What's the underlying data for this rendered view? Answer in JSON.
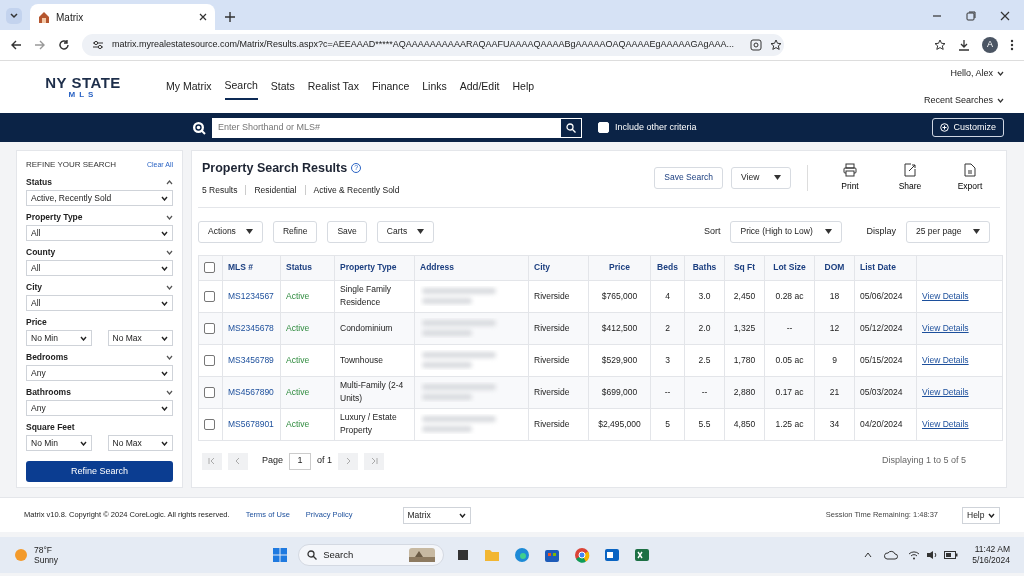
{
  "browser": {
    "tab_title": "Matrix",
    "url": "matrix.myrealestatesource.com/Matrix/Results.aspx?c=AEEAAAD*****AQAAAAAAAAAARAQAAFUAAAAQAAAABgAAAAAOAQAAAAEgAAAAAGAgAAA...",
    "profile": "A"
  },
  "site": {
    "logo_top": "NY STATE",
    "logo_bottom": "MLS",
    "nav": [
      {
        "label": "My Matrix",
        "selected": false
      },
      {
        "label": "Search",
        "selected": true
      },
      {
        "label": "Stats",
        "selected": false
      },
      {
        "label": "Realist Tax",
        "selected": false
      },
      {
        "label": "Finance",
        "selected": false
      },
      {
        "label": "Links",
        "selected": false
      },
      {
        "label": "Add/Edit",
        "selected": false
      },
      {
        "label": "Help",
        "selected": false
      }
    ],
    "greeting": "Hello, Alex",
    "recent": "Recent Searches"
  },
  "searchbar": {
    "placeholder": "Enter Shorthand or MLS#",
    "include_label": "Include other criteria",
    "include_checked": false,
    "customize": "Customize"
  },
  "refine": {
    "title": "REFINE YOUR SEARCH",
    "clear": "Clear All",
    "filters": [
      {
        "label": "Status",
        "expanded": true,
        "values": [
          "Active, Recently Sold"
        ]
      },
      {
        "label": "Property Type",
        "expanded": false,
        "values": [
          "All"
        ]
      },
      {
        "label": "County",
        "expanded": false,
        "values": [
          "All"
        ]
      },
      {
        "label": "City",
        "expanded": false,
        "values": [
          "All"
        ]
      },
      {
        "label": "Price",
        "values": [
          "No Min",
          "No Max"
        ]
      },
      {
        "label": "Bedrooms",
        "expanded": false,
        "values": [
          "Any"
        ]
      },
      {
        "label": "Bathrooms",
        "expanded": false,
        "values": [
          "Any"
        ]
      },
      {
        "label": "Square Feet",
        "values": [
          "No Min",
          "No Max"
        ]
      }
    ],
    "button": "Refine Search"
  },
  "results": {
    "title": "Property Search Results",
    "help": "?",
    "summary": [
      "5 Results",
      "Residential",
      "Active & Recently Sold"
    ],
    "save_search": "Save Search",
    "view": "View",
    "tools": [
      {
        "label": "Print",
        "kind": "print"
      },
      {
        "label": "Share",
        "kind": "share"
      },
      {
        "label": "Export",
        "kind": "export"
      }
    ],
    "actions": [
      {
        "label": "Actions",
        "kind": "dropdown"
      },
      {
        "label": "Refine",
        "kind": "plain"
      },
      {
        "label": "Save",
        "kind": "plain"
      },
      {
        "label": "Carts",
        "kind": "dropdown"
      }
    ],
    "sort_label": "Sort",
    "sort_value": "Price (High to Low)",
    "display_label": "Display",
    "display_value": "25 per page",
    "select_all": false,
    "columns": [
      "MLS #",
      "Status",
      "Property Type",
      "Address",
      "City",
      "Price",
      "Beds",
      "Baths",
      "Sq Ft",
      "Lot Size",
      "DOM",
      "List Date"
    ],
    "rows": [
      {
        "selected": false,
        "mls": "MS1234567",
        "status": "Active",
        "type": "Single Family Residence",
        "city": "Riverside",
        "price": "$765,000",
        "beds": "4",
        "baths": "3.0",
        "sqft": "2,450",
        "lot": "0.28 ac",
        "dom": "18",
        "date": "05/06/2024",
        "link": "View Details"
      },
      {
        "selected": false,
        "mls": "MS2345678",
        "status": "Active",
        "type": "Condominium",
        "city": "Riverside",
        "price": "$412,500",
        "beds": "2",
        "baths": "2.0",
        "sqft": "1,325",
        "lot": "--",
        "dom": "12",
        "date": "05/12/2024",
        "link": "View Details"
      },
      {
        "selected": false,
        "mls": "MS3456789",
        "status": "Active",
        "type": "Townhouse",
        "city": "Riverside",
        "price": "$529,900",
        "beds": "3",
        "baths": "2.5",
        "sqft": "1,780",
        "lot": "0.05 ac",
        "dom": "9",
        "date": "05/15/2024",
        "link": "View Details"
      },
      {
        "selected": false,
        "mls": "MS4567890",
        "status": "Active",
        "type": "Multi-Family (2-4 Units)",
        "city": "Riverside",
        "price": "$699,000",
        "beds": "--",
        "baths": "--",
        "sqft": "2,880",
        "lot": "0.17 ac",
        "dom": "21",
        "date": "05/03/2024",
        "link": "View Details"
      },
      {
        "selected": false,
        "mls": "MS5678901",
        "status": "Active",
        "type": "Luxury / Estate Property",
        "city": "Riverside",
        "price": "$2,495,000",
        "beds": "5",
        "baths": "5.5",
        "sqft": "4,850",
        "lot": "1.25 ac",
        "dom": "34",
        "date": "04/20/2024",
        "link": "View Details"
      }
    ],
    "pager": {
      "page_label": "Page",
      "page": "1",
      "of": "of 1"
    },
    "displaying": "Displaying 1 to 5 of 5"
  },
  "footer": {
    "copyright": "Matrix v10.8. Copyright © 2024 CoreLogic. All rights reserved.",
    "links": [
      "Terms of Use",
      "Privacy Policy"
    ],
    "app": "Matrix",
    "session": "Session Time Remaining: 1:48:37",
    "help": "Help"
  },
  "taskbar": {
    "temp": "78°F",
    "weather": "Sunny",
    "search": "Search",
    "time": "11:42 AM",
    "date": "5/16/2024"
  }
}
